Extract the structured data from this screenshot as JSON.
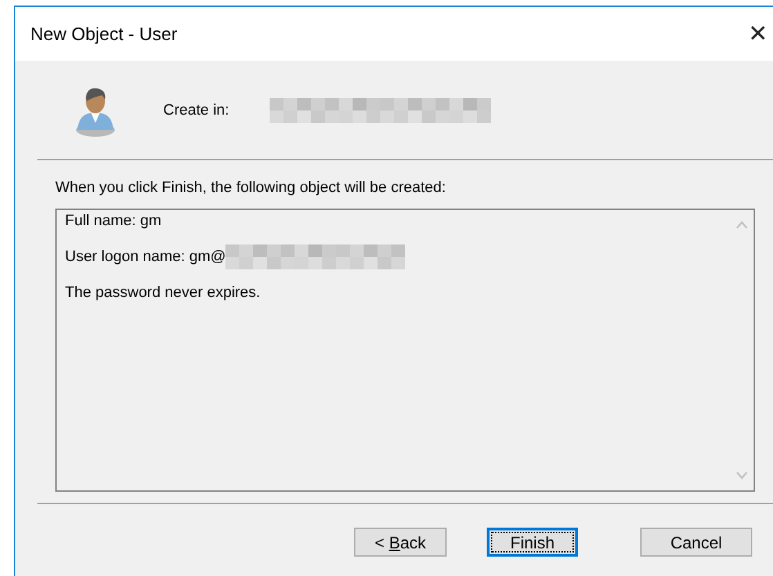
{
  "window": {
    "title": "New Object - User",
    "close_glyph": "✕"
  },
  "create_in": {
    "label": "Create in:"
  },
  "intro": "When you click Finish, the following object will be created:",
  "summary": {
    "lines": [
      {
        "text": "Full name: gm",
        "redacted": false
      },
      {
        "text": "User logon name: gm@",
        "redacted": true
      },
      {
        "text": "The password never expires.",
        "redacted": false
      }
    ]
  },
  "buttons": [
    {
      "label": "< Back",
      "underline_last_word_initial": true,
      "default": false
    },
    {
      "label": "Finish",
      "default": true
    },
    {
      "label": "Cancel",
      "default": false
    }
  ]
}
